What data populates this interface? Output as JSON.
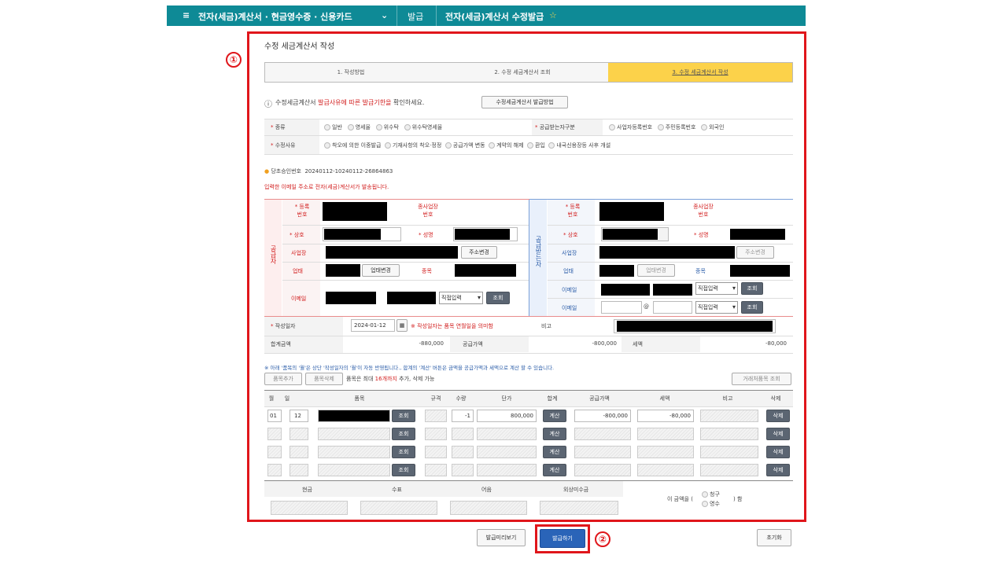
{
  "nav": {
    "menu_title": "전자(세금)계산서 · 현금영수증 · 신용카드",
    "crumb1": "발급",
    "crumb2": "전자(세금)계산서 수정발급",
    "star": "☆"
  },
  "callouts": {
    "one": "①",
    "two": "②"
  },
  "page_title": "수정 세금계산서 작성",
  "steps": [
    "1. 작성방법",
    "2. 수정 세금계산서 조회",
    "3. 수정 세금계산서 작성"
  ],
  "notice": {
    "prefix": "수정세금계산서",
    "red": "발급사유에 따른 발급기한을",
    "suffix": "확인하세요.",
    "button": "수정세금계산서 발급방법"
  },
  "type_row": {
    "label": "종류",
    "options": [
      "일반",
      "영세율",
      "위수탁",
      "위수탁영세율"
    ],
    "label2": "공급받는자구분",
    "options2": [
      "사업자등록번호",
      "주민등록번호",
      "외국인"
    ]
  },
  "reason_row": {
    "label": "수정사유",
    "options": [
      "착오에 의한 이중발급",
      "기재사항의 착오·정정",
      "공급가액 변동",
      "계약의 해제",
      "환입",
      "내국신용장등 사후 개설"
    ]
  },
  "approval": {
    "label": "당초승인번호",
    "value": "20240112-10240112-26864863"
  },
  "email_notice": "입력한 이메일 주소로 전자(세금)계산서가 발송됩니다.",
  "supplier": {
    "section": "공급자",
    "reg_no": "등록\n번호",
    "sub_no": "종사업장\n번호",
    "name": "상호",
    "rep": "성명",
    "addr": "사업장",
    "addr_btn": "주소변경",
    "biz_type": "업태",
    "biz_btn": "업태변경",
    "item": "종목",
    "email": "이메일",
    "email_select": "직접입력",
    "lookup": "조회"
  },
  "buyer": {
    "section": "공급받는자",
    "reg_no": "등록\n번호",
    "sub_no": "종사업장\n번호",
    "name": "상호",
    "rep": "성명",
    "addr": "사업장",
    "addr_btn": "주소변경",
    "biz_type": "업태",
    "biz_btn": "업태변경",
    "item": "종목",
    "email": "이메일",
    "email2": "이메일",
    "at": "@",
    "email_select": "직접입력",
    "lookup": "조회"
  },
  "dates": {
    "write_label": "작성일자",
    "write_value": "2024-01-12",
    "write_note": "※ 작성일자는 품목 연월일을 의미함",
    "memo_label": "비고",
    "total_label": "합계금액",
    "total_value": "-880,000",
    "supply_label": "공급가액",
    "supply_value": "-800,000",
    "tax_label": "세액",
    "tax_value": "-80,000"
  },
  "items_notice": "※ 아래 '품목의 '월'은 상단 '작성일자의 '월'이 자동 반영됩니다., 합계의 '계산' 버튼은 금액을 공급가액과 세액으로 계산 할 수 있습니다.",
  "items_buttons": {
    "add": "품목추가",
    "del": "품목삭제",
    "text1": "품목은 최대",
    "max": "16개까지",
    "text2": "추가, 삭제 가능",
    "trade_lookup": "거래처품목 조회"
  },
  "items_header": [
    "월",
    "일",
    "품목",
    "규격",
    "수량",
    "단가",
    "합계",
    "공급가액",
    "세액",
    "비고",
    "삭제"
  ],
  "items_rows": [
    {
      "month": "01",
      "day": "12",
      "qty": "-1",
      "price": "800,000",
      "supply": "-800,000",
      "tax": "-80,000"
    },
    {
      "month": "",
      "day": "",
      "qty": "",
      "price": "",
      "supply": "",
      "tax": ""
    },
    {
      "month": "",
      "day": "",
      "qty": "",
      "price": "",
      "supply": "",
      "tax": ""
    },
    {
      "month": "",
      "day": "",
      "qty": "",
      "price": "",
      "supply": "",
      "tax": ""
    }
  ],
  "row_buttons": {
    "lookup": "조회",
    "calc": "계산",
    "delete": "삭제"
  },
  "payment": {
    "headers": [
      "현금",
      "수표",
      "어음",
      "외상미수금"
    ],
    "text_pre": "이 금액을 (",
    "opt1": "영수",
    "opt2": "청구",
    "text_post": ") 함"
  },
  "footer": {
    "preview": "발급미리보기",
    "issue": "발급하기",
    "reset": "초기화"
  }
}
